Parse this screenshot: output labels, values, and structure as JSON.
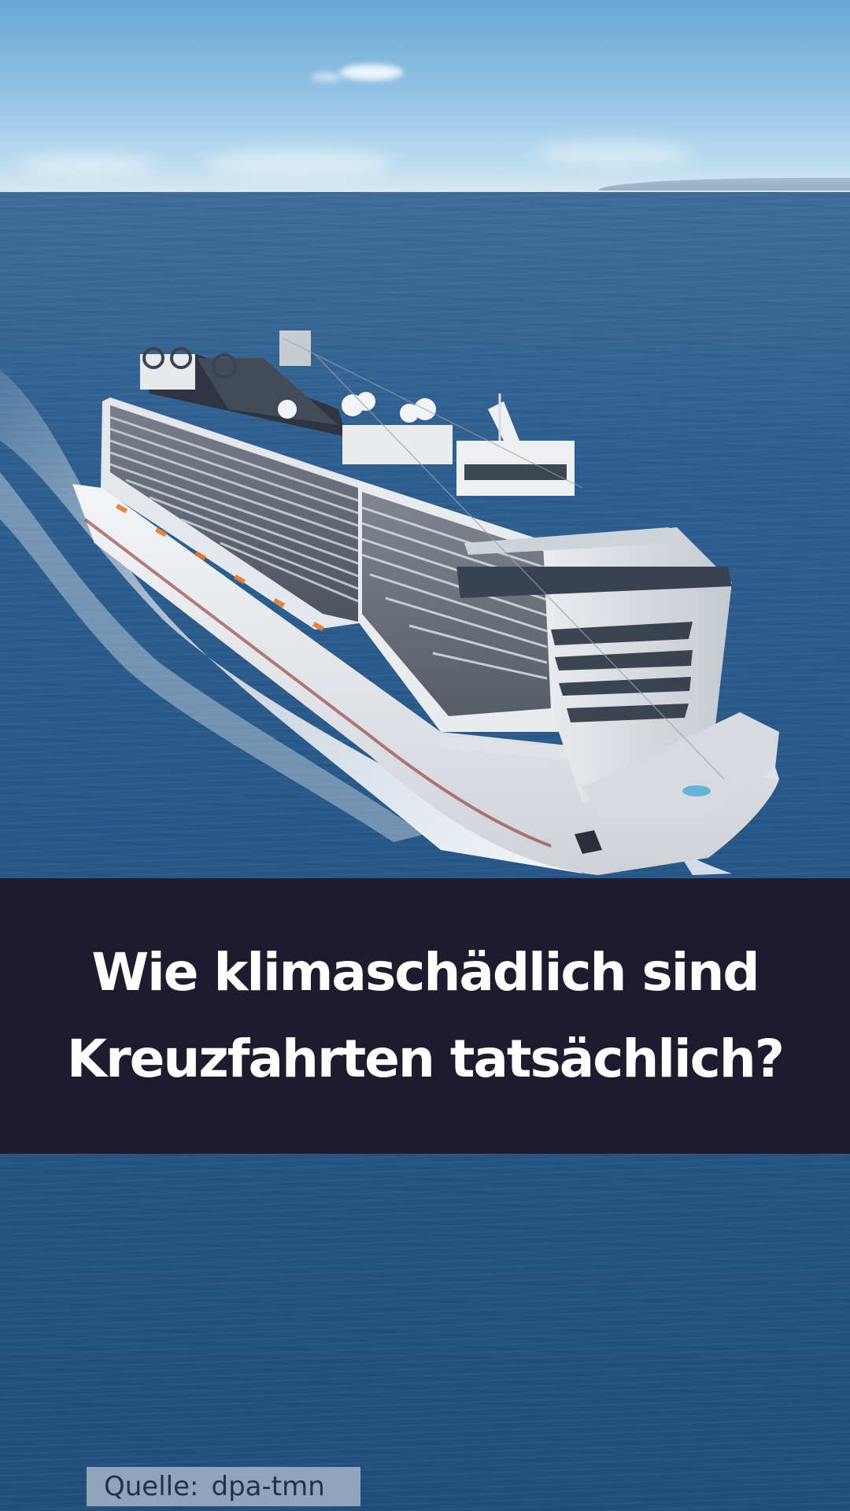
{
  "headline": {
    "line1": "Wie klimaschädlich sind",
    "line2": "Kreuzfahrten tatsächlich?"
  },
  "source": {
    "label": "Quelle:",
    "value": "dpa-tmn"
  },
  "colors": {
    "band": "#1e1b2e",
    "headline_text": "#ffffff",
    "sea": "#285988",
    "sky": "#8fc0e3",
    "source_bg": "#afbccd"
  }
}
